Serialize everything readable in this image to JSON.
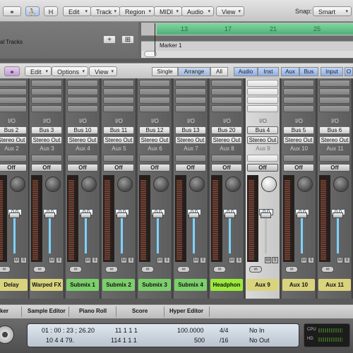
{
  "toolbar": {
    "link_icon": "link-icon",
    "catch_icon": "running-figure-icon",
    "h_label": "H",
    "menus": [
      "Edit",
      "Track",
      "Region",
      "MIDI",
      "Audio",
      "View"
    ],
    "snap_label": "Snap:",
    "snap_value": "Smart"
  },
  "arrange": {
    "global_tracks_label": "al Tracks",
    "add_label": "+",
    "bar_numbers": [
      "13",
      "17",
      "21",
      "25"
    ],
    "marker_label": "Marker 1"
  },
  "mixer": {
    "menus": [
      "Edit",
      "Options",
      "View"
    ],
    "layout_buttons": [
      "Single",
      "Arrange",
      "All"
    ],
    "filters": [
      "Audio",
      "Inst",
      "Aux",
      "Bus",
      "Input",
      "O"
    ],
    "io_label": "I/O",
    "off_label": "Off",
    "strips": [
      {
        "input": "Bus 2",
        "output": "Stereo Out",
        "aux": "Aux 2",
        "vol": "0.0",
        "name": "Delay",
        "color": "#d9d37e"
      },
      {
        "input": "Bus 3",
        "output": "Stereo Out",
        "aux": "Aux 3",
        "vol": "0.0",
        "name": "Warped FX",
        "color": "#d9d37e"
      },
      {
        "input": "Bus 10",
        "output": "Stereo Out",
        "aux": "Aux 4",
        "vol": "0.0",
        "name": "Submix 1",
        "color": "#7ccf6b"
      },
      {
        "input": "Bus 11",
        "output": "Stereo Out",
        "aux": "Aux 5",
        "vol": "0.0",
        "name": "Submix 2",
        "color": "#7ccf6b"
      },
      {
        "input": "Bus 12",
        "output": "Stereo Out",
        "aux": "Aux 6",
        "vol": "0.0",
        "name": "Submix 3",
        "color": "#7ccf6b"
      },
      {
        "input": "Bus 13",
        "output": "Stereo Out",
        "aux": "Aux 7",
        "vol": "0.0",
        "name": "Submix 4",
        "color": "#7ccf6b"
      },
      {
        "input": "Bus 20",
        "output": "Stereo Out",
        "aux": "Aux 8",
        "vol": "0.0",
        "name": "Headphon",
        "color": "#9bea3b"
      },
      {
        "input": "Bus 4",
        "output": "Stereo Out",
        "aux": "Aux 9",
        "vol": "0.0",
        "name": "Aux 9",
        "color": "#d9d37e"
      },
      {
        "input": "Bus 5",
        "output": "Stereo Out",
        "aux": "Aux 10",
        "vol": "0.0",
        "name": "Aux 10",
        "color": "#d9d37e"
      },
      {
        "input": "Bus 6",
        "output": "Stereo Out",
        "aux": "Aux 11",
        "vol": "0.0",
        "name": "Aux 11",
        "color": "#d9d37e"
      }
    ]
  },
  "bottom_tabs": [
    "ker",
    "Sample Editor",
    "Piano Roll",
    "Score",
    "Hyper Editor"
  ],
  "transport": {
    "smpte": "01 : 00 : 23 ; 26.20",
    "bars": "10   4   4   79.",
    "left_locator": "11    1    1    1",
    "right_locator": "114    1    1    1",
    "tempo": "100.0000",
    "tempo_bottom": "500",
    "sig_top": "4/4",
    "sig_bottom": "/16",
    "in_label": "No In",
    "out_label": "No Out",
    "cpu_label": "CPU",
    "hd_label": "HD"
  }
}
